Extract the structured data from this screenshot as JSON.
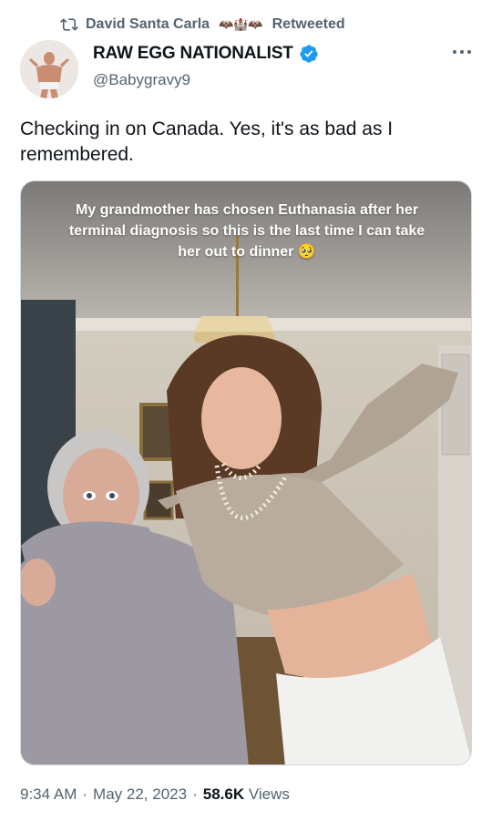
{
  "retweet": {
    "label_name": "David Santa Carla",
    "label_emoji": "🦇🏰🦇",
    "label_action": "Retweeted"
  },
  "author": {
    "display_name": "RAW EGG NATIONALIST",
    "handle": "@Babygravy9",
    "verified": true
  },
  "tweet": {
    "text": "Checking in on Canada. Yes, it's as bad as I remembered.",
    "media_caption": "My grandmother has chosen Euthanasia after her terminal diagnosis so this is the last time I can take her out to dinner 🥺"
  },
  "meta": {
    "time": "9:34 AM",
    "separator": "·",
    "date": "May 22, 2023",
    "views_count": "58.6K",
    "views_label": "Views"
  },
  "colors": {
    "text_primary": "#0f1419",
    "text_secondary": "#536471",
    "verified_blue": "#1d9bf0",
    "border": "#cfd9de"
  },
  "icons": [
    "retweet-icon",
    "verified-badge-icon",
    "more-options-icon"
  ]
}
